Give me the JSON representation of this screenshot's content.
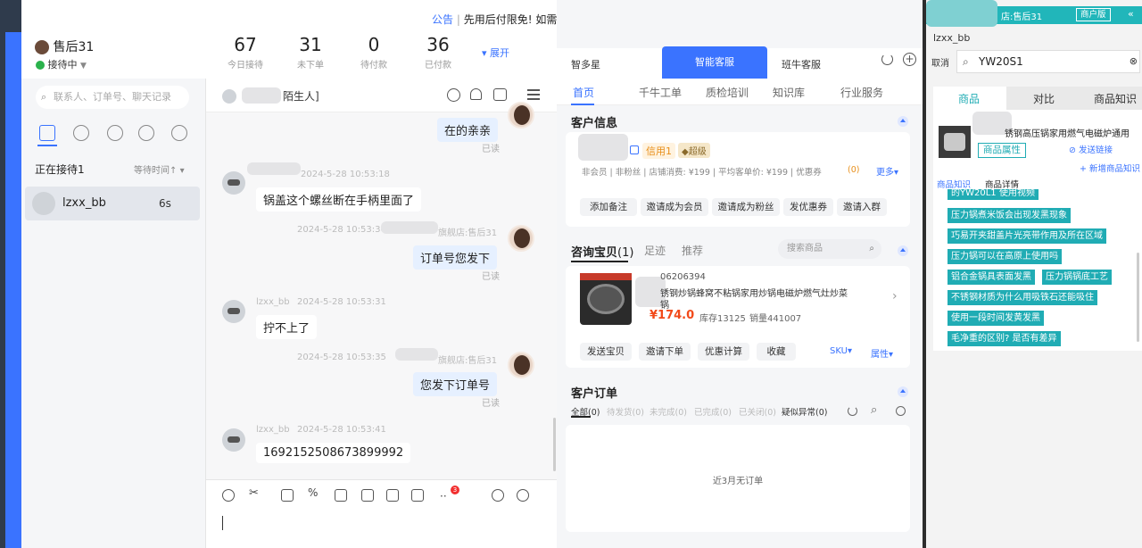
{
  "profile": {
    "name": "售后31",
    "status": "接待中"
  },
  "stats": [
    {
      "value": "67",
      "label": "今日接待"
    },
    {
      "value": "31",
      "label": "未下单"
    },
    {
      "value": "0",
      "label": "待付款"
    },
    {
      "value": "36",
      "label": "已付款"
    }
  ],
  "expand_label": "展开",
  "sidebar": {
    "search_placeholder": "联系人、订单号、聊天记录",
    "receiving_label": "正在接待1",
    "wait_sort": "等待时间↑",
    "session": {
      "name": "lzxx_bb",
      "time": "6s"
    }
  },
  "chat": {
    "header_name": "陌生人]",
    "messages": [
      {
        "side": "right",
        "text": "在的亲亲",
        "read": "已读"
      },
      {
        "side": "left",
        "meta": "2024-5-28 10:53:18",
        "text": "锅盖这个螺丝断在手柄里面了"
      },
      {
        "side": "right",
        "meta": "2024-5-28 10:53:30",
        "shop": "旗舰店:售后31",
        "text": "订单号您发下",
        "read": "已读"
      },
      {
        "side": "left",
        "sender": "lzxx_bb",
        "meta": "2024-5-28 10:53:31",
        "text": "拧不上了"
      },
      {
        "side": "right",
        "meta": "2024-5-28 10:53:35",
        "shop": "旗舰店:售后31",
        "text": "您发下订单号",
        "read": "已读"
      },
      {
        "side": "left",
        "sender": "lzxx_bb",
        "meta": "2024-5-28 10:53:41",
        "text": "1692152508673899992"
      }
    ],
    "toolbar_badge": "3"
  },
  "announce": {
    "tag": "公告",
    "text": "先用后付限免! 如需保留"
  },
  "main": {
    "top_tabs": [
      "智多星",
      "智能客服",
      "班牛客服"
    ],
    "subnav": [
      "首页",
      "千牛工单",
      "质检培训",
      "知识库",
      "行业服务"
    ],
    "customer_info": {
      "title": "客户信息",
      "credit": "信用1",
      "level": "超级",
      "details": "非会员 | 非粉丝 | 店铺消费: ¥199 | 平均客单价: ¥199 | 优惠券",
      "coupon_count": "(0)",
      "more": "更多",
      "actions": [
        "添加备注",
        "邀请成为会员",
        "邀请成为粉丝",
        "发优惠券",
        "邀请入群"
      ]
    },
    "consult": {
      "tabs": [
        "咨询宝贝",
        "(1)",
        "足迹",
        "推荐"
      ],
      "search_placeholder": "搜索商品",
      "product": {
        "id": "06206394",
        "title": "锈钢炒锅蜂窝不粘锅家用炒锅电磁炉燃气灶炒菜",
        "title2": "锅",
        "price": "¥174.0",
        "stock": "库存13125",
        "sales": "销量441007"
      },
      "actions": [
        "发送宝贝",
        "邀请下单",
        "优惠计算",
        "收藏"
      ],
      "sku": "SKU",
      "attr": "属性"
    },
    "orders": {
      "title": "客户订单",
      "filters": [
        "全部(0)",
        "待发货(0)",
        "未完成(0)",
        "已完成(0)",
        "已关闭(0)",
        "疑似异常(0)"
      ],
      "empty": "近3月无订单"
    }
  },
  "right": {
    "header": "店:售后31",
    "merchant_btn": "商户版",
    "user": "lzxx_bb",
    "cancel": "取消",
    "search_value": "YW20S1",
    "tabs": [
      "商品",
      "对比",
      "商品知识"
    ],
    "product_title": "锈钢高压锅家用燃气电磁炉通用",
    "attr_btn": "商品属性",
    "send_link": "发送链接",
    "add_knowledge": "+ 新增商品知识",
    "sub_tabs": [
      "商品知识",
      "商品详情"
    ],
    "qa": [
      "的YW20L1",
      "使用视频",
      "压力锅煮米饭会出现发黑现象",
      "巧易开夹甜盖片光亮带作用及所在区域",
      "压力锅可以在高原上使用吗",
      "铝合金锅具表面发黑",
      "压力锅锅底工艺",
      "不锈钢材质为什么用吸铁石还能吸住",
      "使用一段时间发黄发黑",
      "毛净重的区别? 是否有差异"
    ]
  }
}
